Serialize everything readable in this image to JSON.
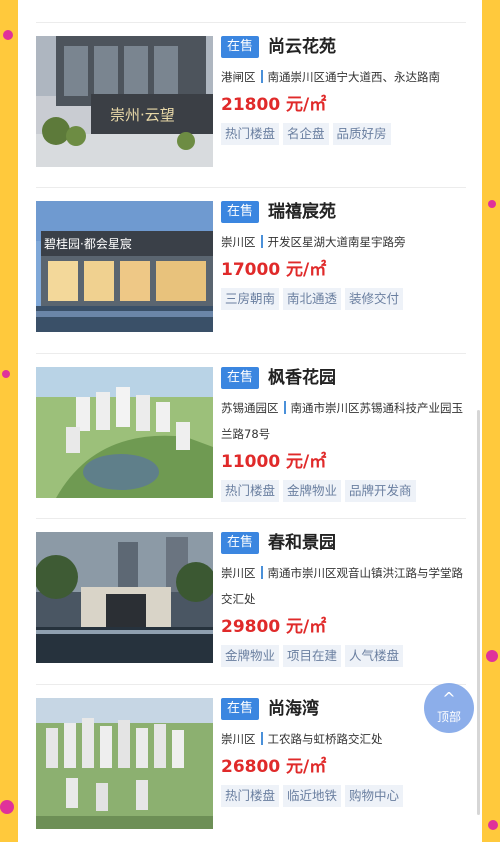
{
  "listings": [
    {
      "status": "在售",
      "name": "尚云花苑",
      "district": "港闸区",
      "address": "南通崇川区通宁大道西、永达路南",
      "address_line2": "",
      "price": "21800 元/㎡",
      "tags": [
        "热门楼盘",
        "名企盘",
        "品质好房"
      ],
      "image_sign": "崇州·云望"
    },
    {
      "status": "在售",
      "name": "瑞禧宸苑",
      "district": "崇川区",
      "address": "开发区星湖大道南星宇路旁",
      "address_line2": "",
      "price": "17000 元/㎡",
      "tags": [
        "三房朝南",
        "南北通透",
        "装修交付"
      ],
      "image_sign": "碧桂园·都会星宸"
    },
    {
      "status": "在售",
      "name": "枫香花园",
      "district": "苏锡通园区",
      "address": "南通市崇川区苏锡通科技产业园玉",
      "address_line2": "兰路78号",
      "price": "11000 元/㎡",
      "tags": [
        "热门楼盘",
        "金牌物业",
        "品牌开发商"
      ],
      "image_sign": ""
    },
    {
      "status": "在售",
      "name": "春和景园",
      "district": "崇川区",
      "address": "南通市崇川区观音山镇洪江路与学堂路",
      "address_line2": "交汇处",
      "price": "29800 元/㎡",
      "tags": [
        "金牌物业",
        "项目在建",
        "人气楼盘"
      ],
      "image_sign": ""
    },
    {
      "status": "在售",
      "name": "尚海湾",
      "district": "崇川区",
      "address": "工农路与虹桥路交汇处",
      "address_line2": "",
      "price": "26800 元/㎡",
      "tags": [
        "热门楼盘",
        "临近地铁",
        "购物中心"
      ],
      "image_sign": ""
    }
  ],
  "back_to_top": {
    "arrow": "^",
    "label": "顶部"
  },
  "colors": {
    "accent": "#3b86e0",
    "price": "#e02a2a",
    "background": "#ffc93c"
  },
  "icons": [
    "arrow-up-icon"
  ]
}
